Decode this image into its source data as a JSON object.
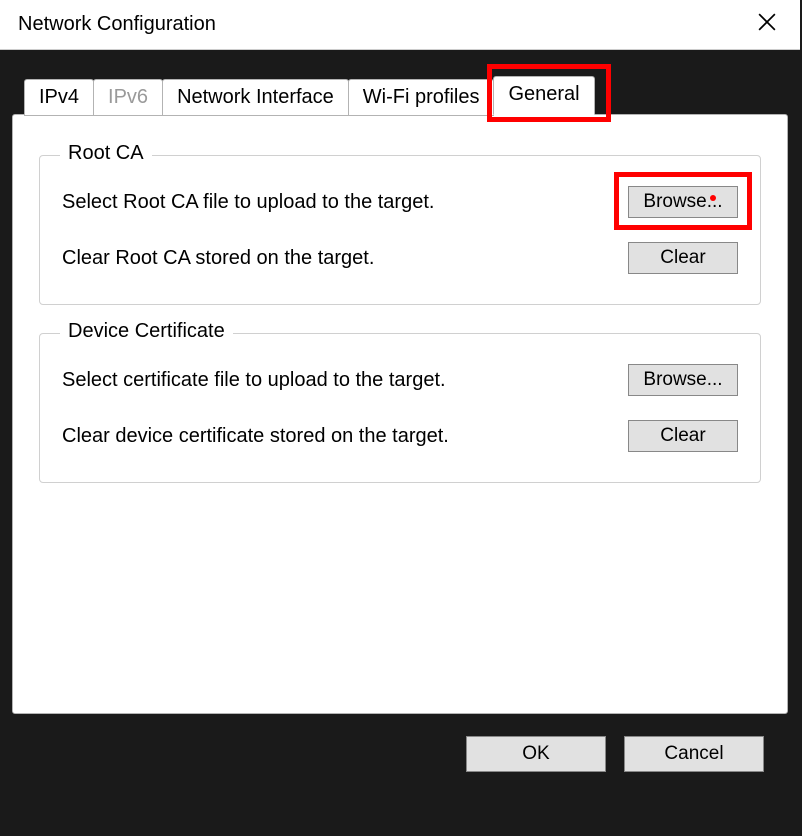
{
  "window": {
    "title": "Network Configuration"
  },
  "tabs": {
    "ipv4": "IPv4",
    "ipv6": "IPv6",
    "network_interface": "Network Interface",
    "wifi_profiles": "Wi-Fi profiles",
    "general": "General"
  },
  "rootca": {
    "legend": "Root CA",
    "upload_label": "Select Root CA file to upload to the target.",
    "clear_label": "Clear Root CA stored on the target.",
    "browse_btn": "Browse...",
    "clear_btn": "Clear"
  },
  "devcert": {
    "legend": "Device Certificate",
    "upload_label": "Select certificate file to upload to the target.",
    "clear_label": "Clear device certificate stored on the target.",
    "browse_btn": "Browse...",
    "clear_btn": "Clear"
  },
  "footer": {
    "ok": "OK",
    "cancel": "Cancel"
  }
}
